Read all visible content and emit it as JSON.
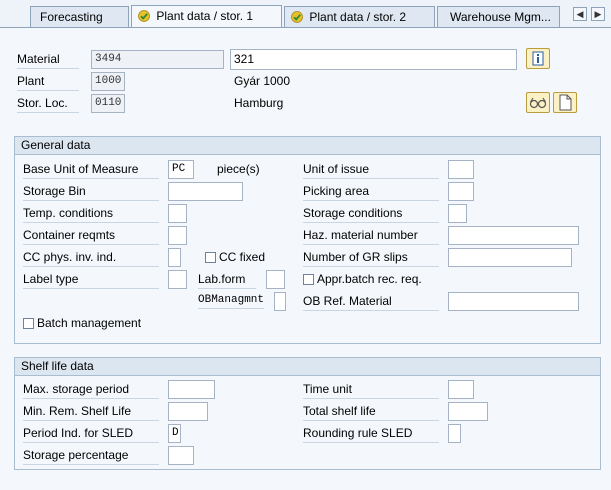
{
  "tabs": [
    {
      "label": "Forecasting",
      "active": false,
      "checked": false
    },
    {
      "label": "Plant data / stor. 1",
      "active": true,
      "checked": true
    },
    {
      "label": "Plant data / stor. 2",
      "active": false,
      "checked": true
    },
    {
      "label": "Warehouse Mgm...",
      "active": false,
      "checked": false
    }
  ],
  "header": {
    "material_label": "Material",
    "material_value": "3494",
    "material_desc": "321",
    "plant_label": "Plant",
    "plant_value": "1000",
    "plant_desc": "Gyár 1000",
    "storloc_label": "Stor. Loc.",
    "storloc_value": "0110",
    "storloc_desc": "Hamburg"
  },
  "general": {
    "title": "General data",
    "base_uom_label": "Base Unit of Measure",
    "base_uom_value": "PC",
    "base_uom_text": "piece(s)",
    "unit_of_issue_label": "Unit of issue",
    "storage_bin_label": "Storage Bin",
    "picking_area_label": "Picking area",
    "temp_cond_label": "Temp. conditions",
    "storage_cond_label": "Storage conditions",
    "container_req_label": "Container reqmts",
    "haz_material_label": "Haz. material number",
    "cc_phys_label": "CC phys. inv. ind.",
    "cc_fixed_label": "CC fixed",
    "gr_slips_label": "Number of GR slips",
    "label_type_label": "Label type",
    "lab_form_label": "Lab.form",
    "appr_batch_label": "Appr.batch rec. req.",
    "ob_mgmt_label": "OBManagmnt",
    "ob_ref_label": "OB Ref. Material",
    "batch_mgmt_label": "Batch management"
  },
  "shelf": {
    "title": "Shelf life data",
    "max_storage_label": "Max. storage period",
    "time_unit_label": "Time unit",
    "min_rem_label": "Min. Rem. Shelf Life",
    "total_shelf_label": "Total shelf life",
    "period_ind_label": "Period Ind. for SLED",
    "period_ind_value": "D",
    "rounding_label": "Rounding rule SLED",
    "storage_pct_label": "Storage percentage"
  },
  "colors": {
    "accent": "#dce6f1",
    "check_green": "#3a9a3a",
    "check_yellow": "#e6c12a"
  }
}
